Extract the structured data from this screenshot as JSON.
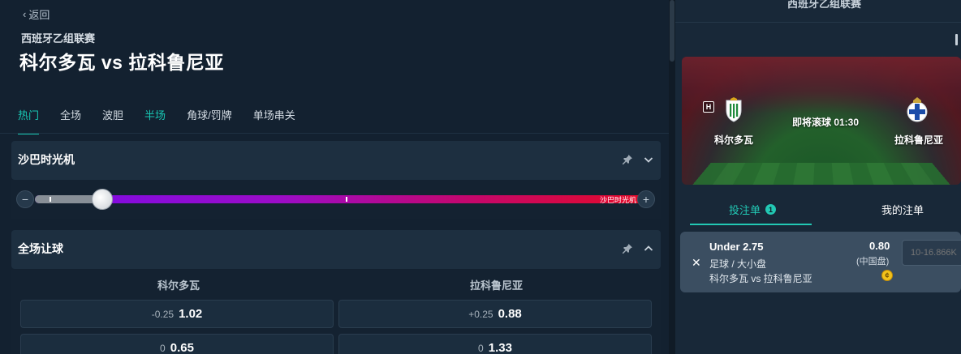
{
  "nav": {
    "back_label": "返回"
  },
  "match": {
    "league": "西班牙乙组联赛",
    "title": "科尔多瓦 vs 拉科鲁尼亚",
    "home": "科尔多瓦",
    "away": "拉科鲁尼亚",
    "status": "即将滚球 01:30",
    "home_flag": "H"
  },
  "tabs": [
    {
      "label": "热门"
    },
    {
      "label": "全场"
    },
    {
      "label": "波胆"
    },
    {
      "label": "半场"
    },
    {
      "label": "角球/罚牌"
    },
    {
      "label": "单场串关"
    }
  ],
  "time_machine": {
    "title": "沙巴时光机",
    "slider_label": "沙巴时光机",
    "minus": "−",
    "plus": "+",
    "level": 0.11
  },
  "handicap": {
    "title": "全场让球",
    "home_header": "科尔多瓦",
    "away_header": "拉科鲁尼亚",
    "rows": [
      {
        "home_hcp": "-0.25",
        "home_price": "1.02",
        "away_hcp": "+0.25",
        "away_price": "0.88"
      },
      {
        "home_hcp": "0",
        "home_price": "0.65",
        "away_hcp": "0",
        "away_price": "1.33"
      }
    ]
  },
  "right_panel": {
    "header_title": "西班牙乙组联赛",
    "bet_tab_label": "投注单",
    "bet_tab_count": "1",
    "my_bets_label": "我的注单"
  },
  "bet_slip": {
    "selection": "Under 2.75",
    "market": "足球 / 大小盘",
    "match": "科尔多瓦 vs 拉科鲁尼亚",
    "odds": "0.80",
    "odds_type": "(中国盘)",
    "coin_symbol": "¢",
    "stake_placeholder": "10-16.866K"
  },
  "colors": {
    "accent": "#18c8b4",
    "background": "#132130",
    "panel": "#1d2f40",
    "slip": "#3b4e61"
  }
}
